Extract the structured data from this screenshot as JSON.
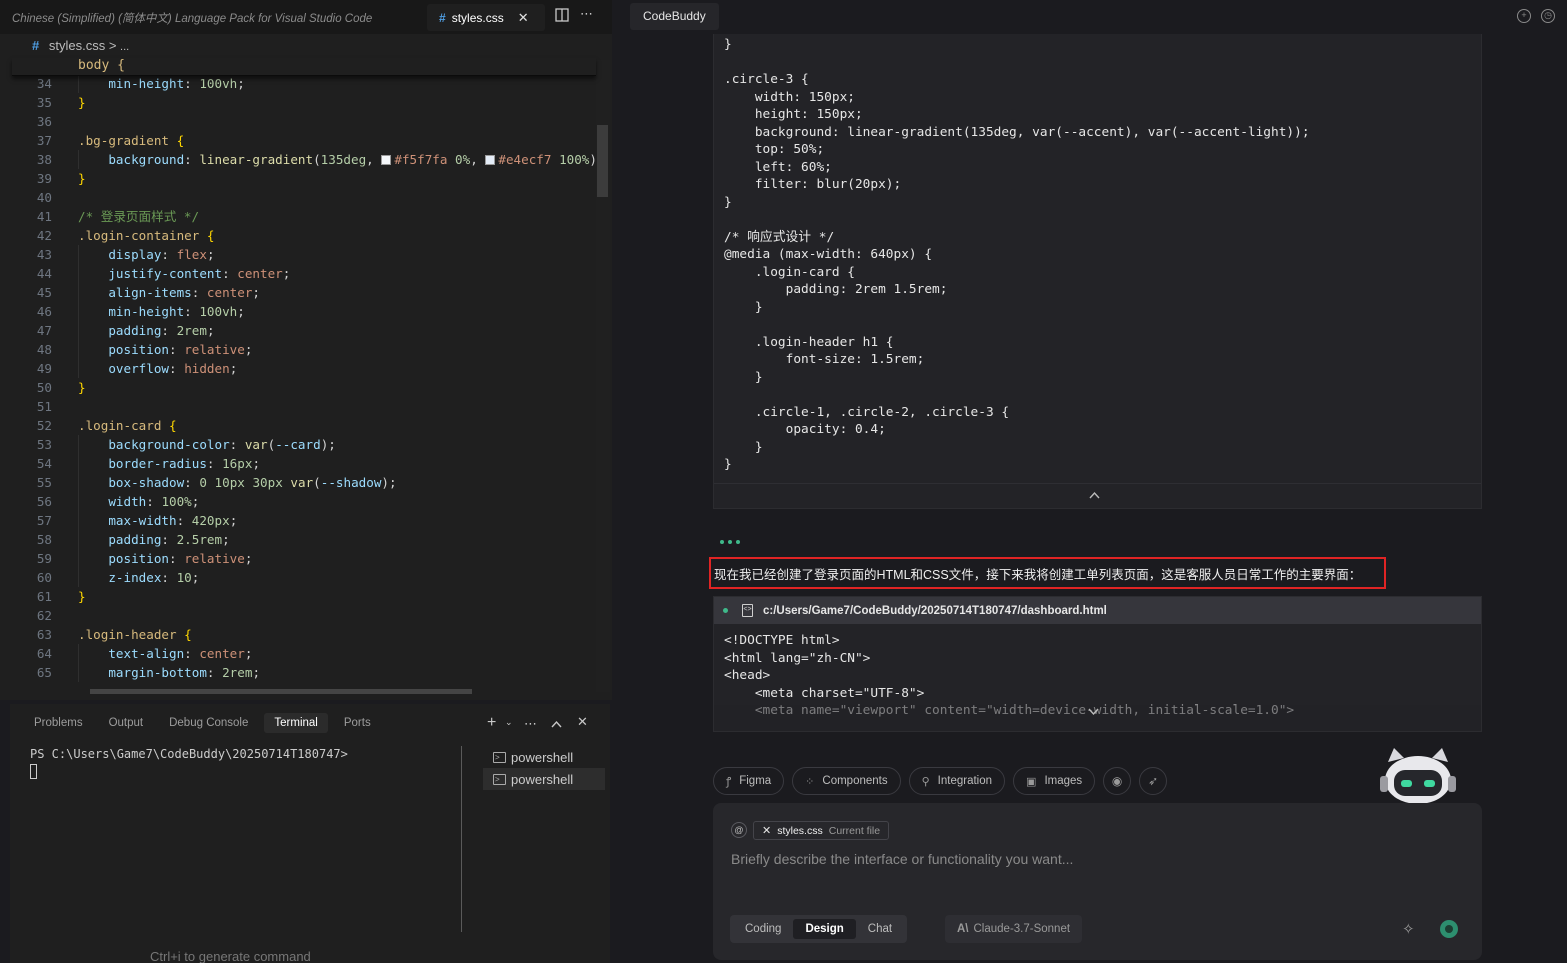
{
  "editor": {
    "tabs": {
      "inactive_tab_label": "Chinese (Simplified) (简体中文) Language Pack for Visual Studio Code",
      "active_tab_label": "styles.css",
      "active_tab_file_icon": "#"
    },
    "toolbar_icons": [
      "split-editor-icon",
      "more-actions-icon"
    ],
    "breadcrumb": {
      "icon": "#",
      "file": "styles.css",
      "separator": ">",
      "more": "..."
    },
    "sticky_scroll": "body {",
    "lines": [
      {
        "n": "34",
        "content": "    min-height: 100vh;"
      },
      {
        "n": "35",
        "content": "}"
      },
      {
        "n": "36",
        "content": ""
      },
      {
        "n": "37",
        "content": ".bg-gradient {"
      },
      {
        "n": "38",
        "content": "    background: linear-gradient(135deg, #f5f7fa 0%, #e4ecf7 100%)"
      },
      {
        "n": "39",
        "content": "}"
      },
      {
        "n": "40",
        "content": ""
      },
      {
        "n": "41",
        "content": "/* 登录页面样式 */"
      },
      {
        "n": "42",
        "content": ".login-container {"
      },
      {
        "n": "43",
        "content": "    display: flex;"
      },
      {
        "n": "44",
        "content": "    justify-content: center;"
      },
      {
        "n": "45",
        "content": "    align-items: center;"
      },
      {
        "n": "46",
        "content": "    min-height: 100vh;"
      },
      {
        "n": "47",
        "content": "    padding: 2rem;"
      },
      {
        "n": "48",
        "content": "    position: relative;"
      },
      {
        "n": "49",
        "content": "    overflow: hidden;"
      },
      {
        "n": "50",
        "content": "}"
      },
      {
        "n": "51",
        "content": ""
      },
      {
        "n": "52",
        "content": ".login-card {"
      },
      {
        "n": "53",
        "content": "    background-color: var(--card);"
      },
      {
        "n": "54",
        "content": "    border-radius: 16px;"
      },
      {
        "n": "55",
        "content": "    box-shadow: 0 10px 30px var(--shadow);"
      },
      {
        "n": "56",
        "content": "    width: 100%;"
      },
      {
        "n": "57",
        "content": "    max-width: 420px;"
      },
      {
        "n": "58",
        "content": "    padding: 2.5rem;"
      },
      {
        "n": "59",
        "content": "    position: relative;"
      },
      {
        "n": "60",
        "content": "    z-index: 10;"
      },
      {
        "n": "61",
        "content": "}"
      },
      {
        "n": "62",
        "content": ""
      },
      {
        "n": "63",
        "content": ".login-header {"
      },
      {
        "n": "64",
        "content": "    text-align: center;"
      },
      {
        "n": "65",
        "content": "    margin-bottom: 2rem;"
      }
    ],
    "swatch_colors": [
      "#f5f7fa",
      "#e4ecf7"
    ]
  },
  "panel": {
    "tabs": [
      "Problems",
      "Output",
      "Debug Console",
      "Terminal",
      "Ports"
    ],
    "active_tab": "Terminal",
    "actions": [
      "add-terminal-icon",
      "chevron-down-icon",
      "more-icon",
      "maximize-icon",
      "close-icon"
    ],
    "prompt": "PS C:\\Users\\Game7\\CodeBuddy\\20250714T180747>",
    "terminals": [
      "powershell",
      "powershell"
    ],
    "hint": "Ctrl+i to generate command"
  },
  "codebuddy": {
    "tab_label": "CodeBuddy",
    "header_icons": [
      "new-chat-icon",
      "history-icon"
    ],
    "code_block_1": "}\n\n.circle-3 {\n    width: 150px;\n    height: 150px;\n    background: linear-gradient(135deg, var(--accent), var(--accent-light));\n    top: 50%;\n    left: 60%;\n    filter: blur(20px);\n}\n\n/* 响应式设计 */\n@media (max-width: 640px) {\n    .login-card {\n        padding: 2rem 1.5rem;\n    }\n\n    .login-header h1 {\n        font-size: 1.5rem;\n    }\n\n    .circle-1, .circle-2, .circle-3 {\n        opacity: 0.4;\n    }\n}",
    "message": "现在我已经创建了登录页面的HTML和CSS文件，接下来我将创建工单列表页面，这是客服人员日常工作的主要界面：",
    "file_card": {
      "path": "c:/Users/Game7/CodeBuddy/20250714T180747/dashboard.html",
      "code": "<!DOCTYPE html>\n<html lang=\"zh-CN\">\n<head>\n    <meta charset=\"UTF-8\">\n    <meta name=\"viewport\" content=\"width=device-width, initial-scale=1.0\">"
    },
    "chips": [
      {
        "label": "Figma",
        "icon": "figma-icon"
      },
      {
        "label": "Components",
        "icon": "components-icon"
      },
      {
        "label": "Integration",
        "icon": "integration-icon"
      },
      {
        "label": "Images",
        "icon": "images-icon"
      }
    ],
    "chip_icons": [
      "preview-eye-icon",
      "deploy-rocket-icon"
    ],
    "input": {
      "context_file": "styles.css",
      "context_tag": "Current file",
      "placeholder": "Briefly describe the interface or functionality you want..."
    },
    "modes": [
      "Coding",
      "Design",
      "Chat"
    ],
    "active_mode": "Design",
    "model": "Claude-3.7-Sonnet",
    "model_icon": "A\\",
    "accent_color": "#3fb98a",
    "highlight_color": "#e02424"
  }
}
